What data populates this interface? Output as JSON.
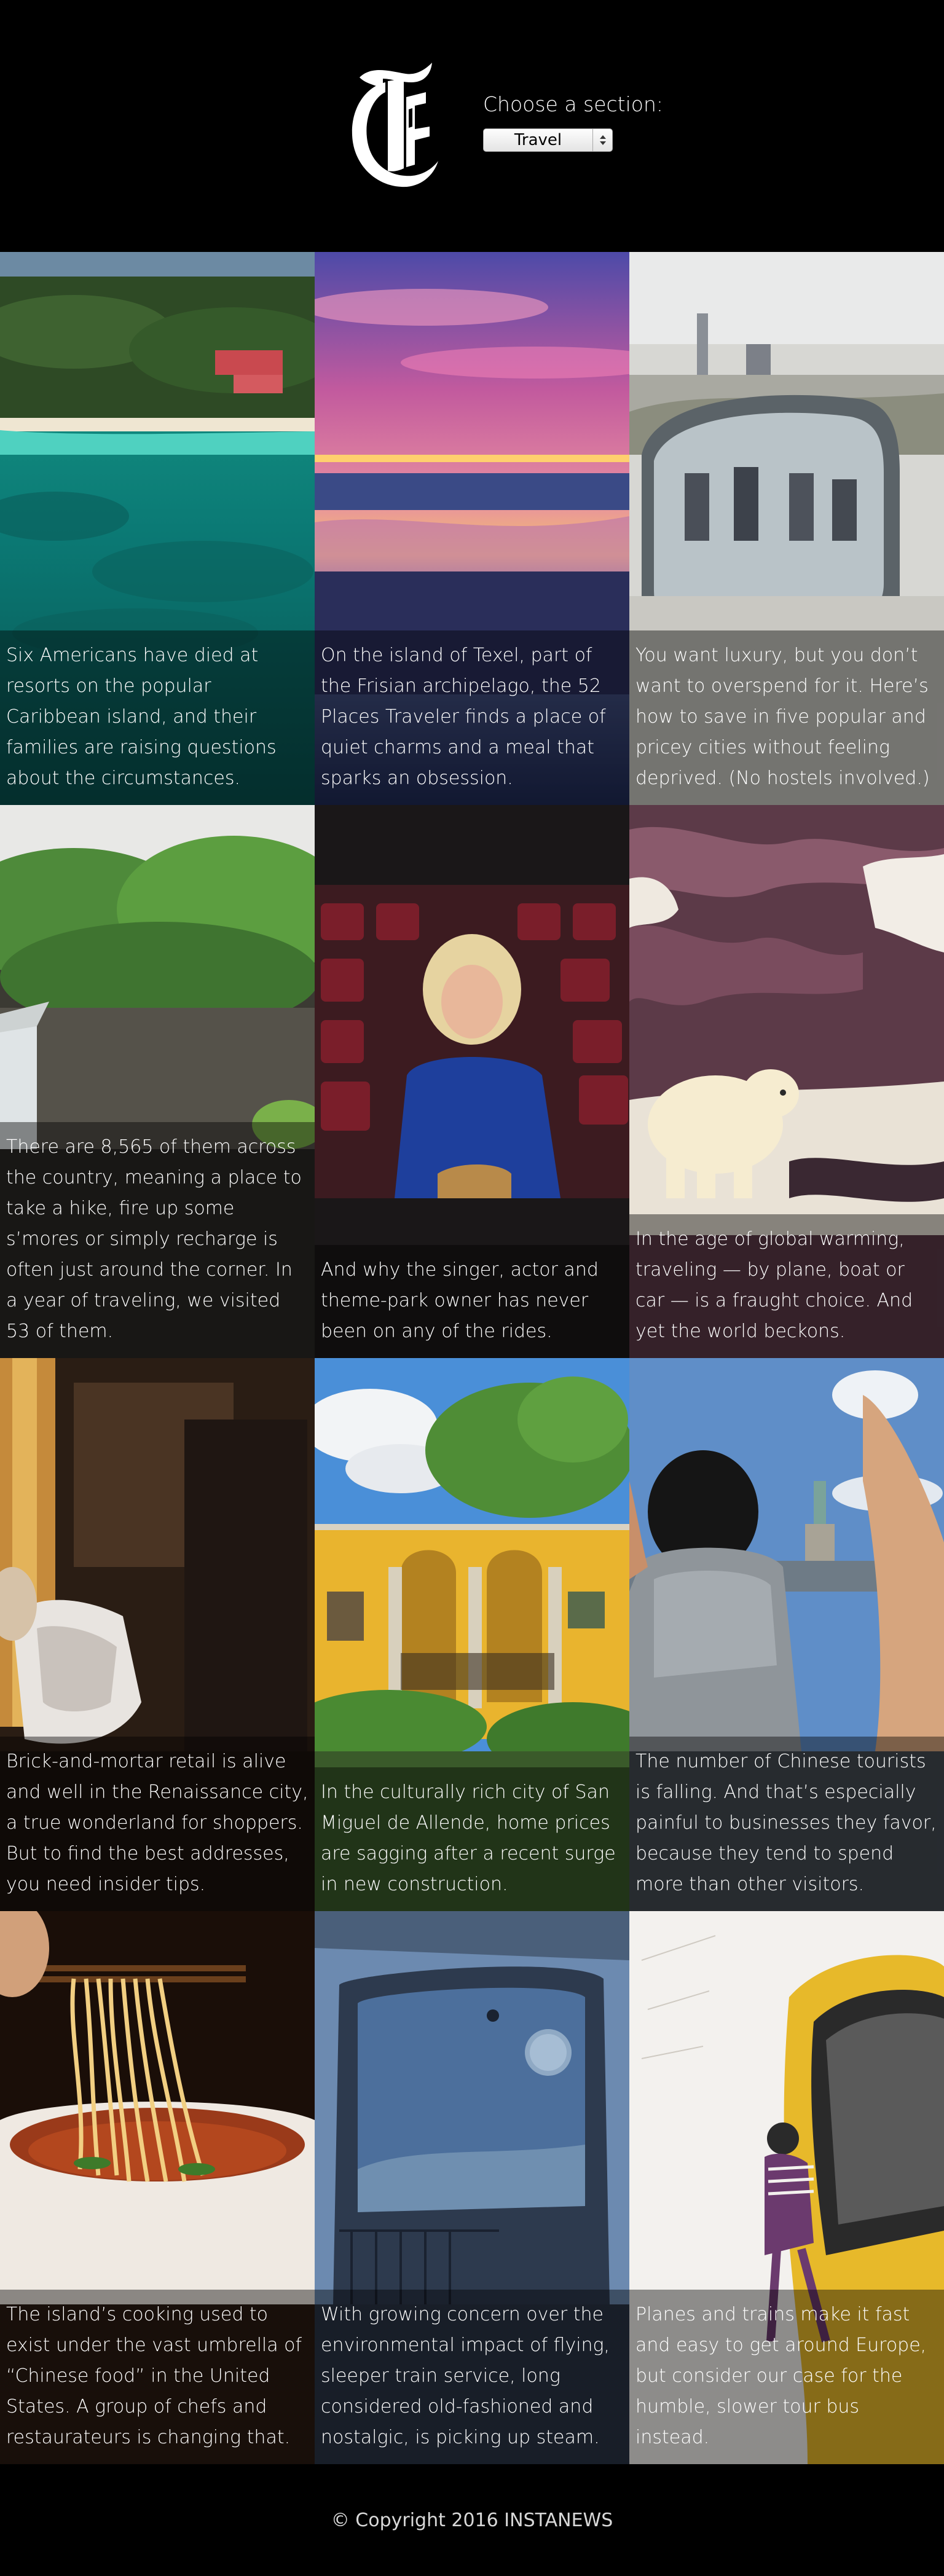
{
  "header": {
    "logo": "nyt-t-logo-icon",
    "section_label": "Choose a section:",
    "section_select": {
      "selected": "Travel",
      "arrow_icon": "chevron-up-down-icon"
    }
  },
  "stories": [
    {
      "caption": "Six Americans have died at resorts on the popular Caribbean island, and their families are raising questions about the circumstances."
    },
    {
      "caption": "On the island of Texel, part of the Frisian archipelago, the 52 Places Traveler finds a place of quiet charms and a meal that sparks an obsession."
    },
    {
      "caption": "You want luxury, but you don’t want to overspend for it. Here’s how to save in five popular and pricey cities without feeling deprived. (No hostels involved.)"
    },
    {
      "caption": "There are 8,565 of them across the country, meaning a place to take a hike, fire up some s’mores or simply recharge is often just around the corner. In a year of traveling, we visited 53 of them."
    },
    {
      "caption": "And why the singer, actor and theme-park owner has never been on any of the rides."
    },
    {
      "caption": "In the age of global warming, traveling — by plane, boat or car — is a fraught choice. And yet the world beckons."
    },
    {
      "caption": "Brick-and-mortar retail is alive and well in the Renaissance city, a true wonderland for shoppers. But to find the best addresses, you need insider tips."
    },
    {
      "caption": "In the culturally rich city of San Miguel de Allende, home prices are sagging after a recent surge in new construction."
    },
    {
      "caption": "The number of Chinese tourists is falling. And that’s especially painful to businesses they favor, because they tend to spend more than other visitors."
    },
    {
      "caption": "The island’s cooking used to exist under the vast umbrella of “Chinese food” in the United States. A group of chefs and restaurateurs is changing that."
    },
    {
      "caption": "With growing concern over the environmental impact of flying, sleeper train service, long considered old-fashioned and nostalgic, is picking up steam."
    },
    {
      "caption": "Planes and trains make it fast and easy to get around Europe, but consider our case for the humble, slower tour bus instead."
    }
  ],
  "footer": {
    "copyright": "© Copyright 2016 INSTANEWS"
  }
}
